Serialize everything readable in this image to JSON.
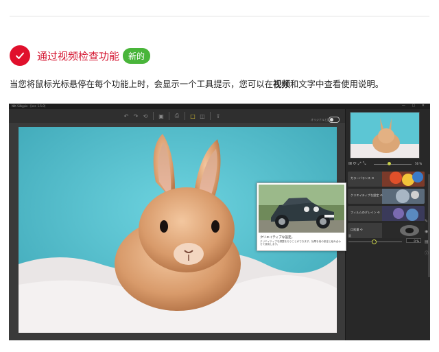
{
  "feature": {
    "title": "通过视频检查功能",
    "badge": "新的",
    "desc_before": "当您将鼠标光标悬停在每个功能上时，会显示一个工具提示，您可以在",
    "desc_bold": "视频",
    "desc_after": "和文字中查看使用说明。"
  },
  "app": {
    "window_title": "NIK Silkypix - [ver. 1.5.0]",
    "compare_label": "オリジナルと比較",
    "zoom_value": "56 %",
    "effects": [
      {
        "label": "カラーバランス ⟲"
      },
      {
        "label": "クリエイティブな設定 ⟲"
      },
      {
        "label": "フィルムのグレイン ⟲"
      },
      {
        "label": "口紅量 ⟲"
      }
    ],
    "strength_label": "量",
    "strength_value": "0 %",
    "tooltip": {
      "title": "クリエイティブな設定。",
      "body": "クリエイティブな調整を行うことができます。効果を他の設定と組み合わせて使用します。"
    }
  },
  "colors": {
    "accent_red": "#e0102c",
    "badge_green": "#49b53a",
    "highlight": "#d8c233"
  }
}
